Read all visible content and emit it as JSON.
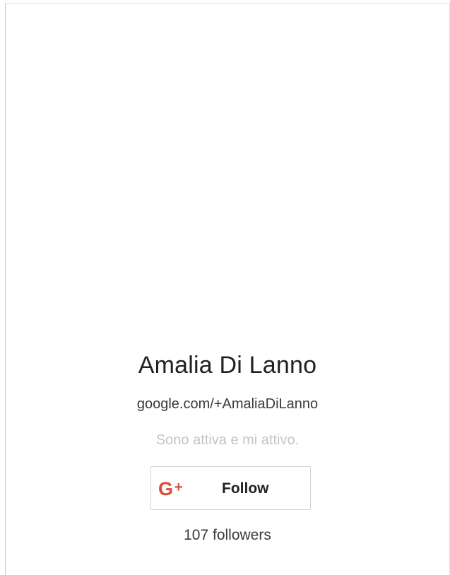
{
  "profile": {
    "name": "Amalia Di Lanno",
    "url": "google.com/+AmaliaDiLanno",
    "tagline": "Sono attiva e mi attivo.",
    "followers": "107 followers"
  },
  "follow_button": {
    "icon": "google-plus-icon",
    "icon_letter": "G",
    "icon_plus": "+",
    "label": "Follow",
    "icon_color": "#dd4b39"
  }
}
